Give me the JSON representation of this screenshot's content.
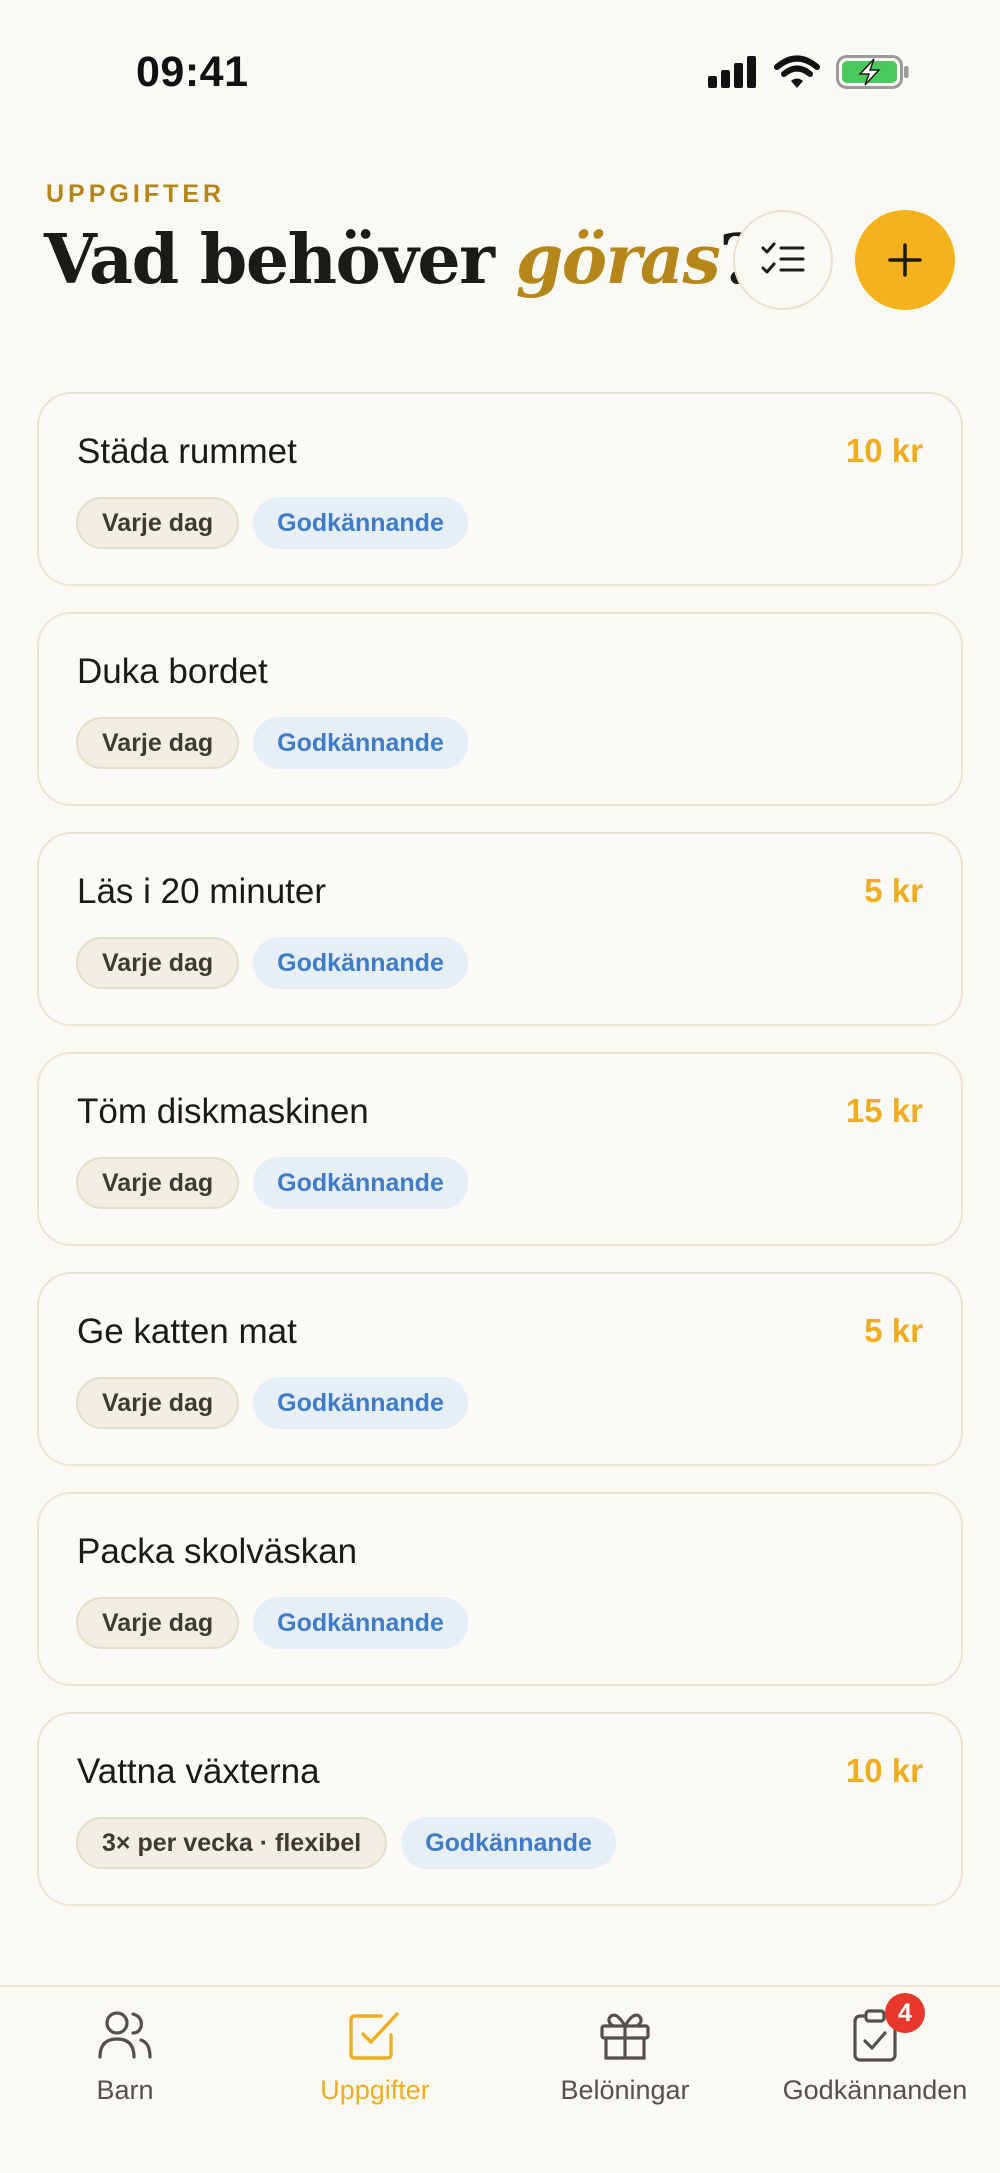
{
  "status_bar": {
    "time": "09:41"
  },
  "header": {
    "eyebrow": "UPPGIFTER",
    "title_main": "Vad behöver ",
    "title_accent": "göras",
    "title_end": "?"
  },
  "tasks": [
    {
      "name": "Städa rummet",
      "reward": "10 kr",
      "schedule": "Varje dag",
      "approval": "Godkännande"
    },
    {
      "name": "Duka bordet",
      "reward": "",
      "schedule": "Varje dag",
      "approval": "Godkännande"
    },
    {
      "name": "Läs i 20 minuter",
      "reward": "5 kr",
      "schedule": "Varje dag",
      "approval": "Godkännande"
    },
    {
      "name": "Töm diskmaskinen",
      "reward": "15 kr",
      "schedule": "Varje dag",
      "approval": "Godkännande"
    },
    {
      "name": "Ge katten mat",
      "reward": "5 kr",
      "schedule": "Varje dag",
      "approval": "Godkännande"
    },
    {
      "name": "Packa skolväskan",
      "reward": "",
      "schedule": "Varje dag",
      "approval": "Godkännande"
    },
    {
      "name": "Vattna växterna",
      "reward": "10 kr",
      "schedule": "3× per vecka · flexibel",
      "approval": "Godkännande"
    }
  ],
  "tab_bar": {
    "tabs": [
      {
        "label": "Barn",
        "icon": "users-icon",
        "active": false
      },
      {
        "label": "Uppgifter",
        "icon": "checkbox-icon",
        "active": true
      },
      {
        "label": "Belöningar",
        "icon": "gift-icon",
        "active": false
      },
      {
        "label": "Godkännanden",
        "icon": "clipboard-check-icon",
        "active": false,
        "badge": "4"
      }
    ]
  },
  "colors": {
    "background": "#FBF9F4",
    "accent_gold": "#B5861A",
    "accent_yellow": "#F5B21C",
    "reward_text": "#EDAE22",
    "approval_blue": "#3F7CC8",
    "badge_red": "#E8382E"
  }
}
